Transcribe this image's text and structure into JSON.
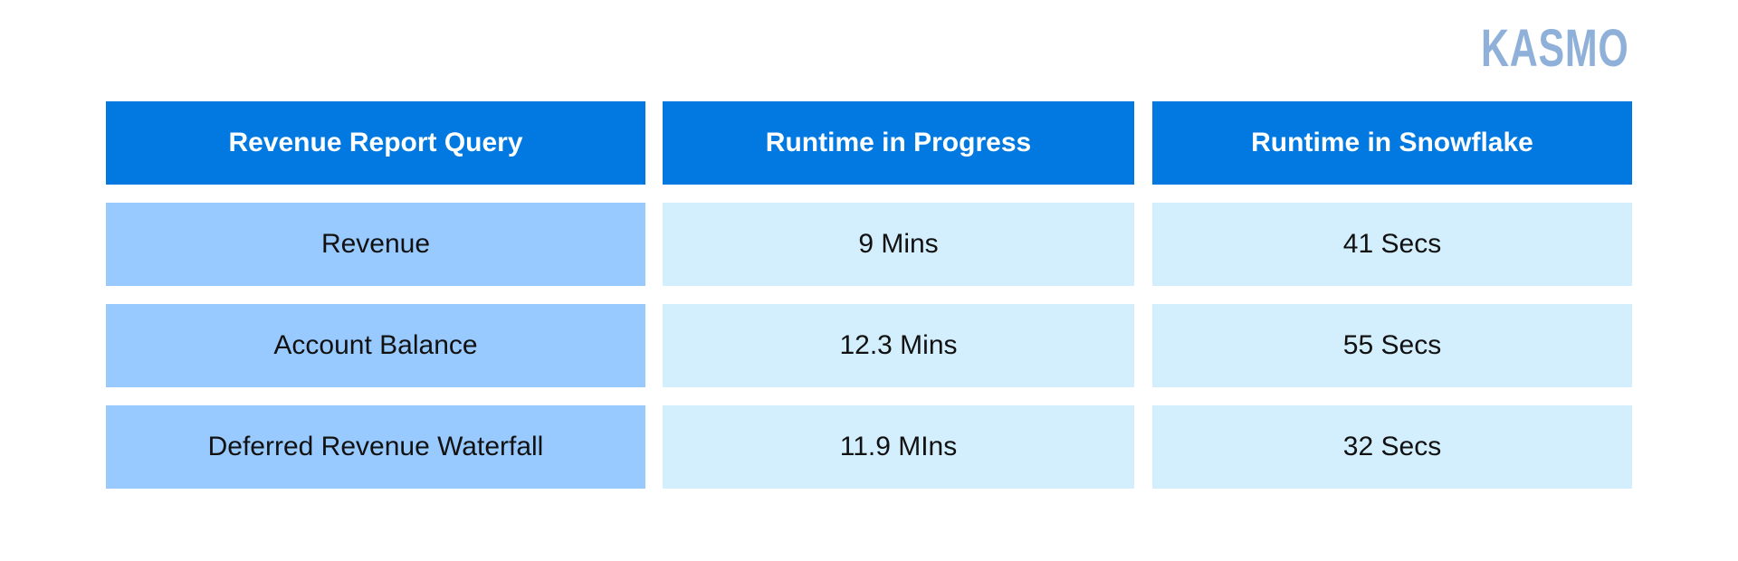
{
  "brand": {
    "logo_text": "KASMO",
    "color": "#8fb0d9"
  },
  "colors": {
    "header_bg": "#0179e0",
    "first_column_bg": "#99caff",
    "value_cell_bg": "#d3effd"
  },
  "table": {
    "headers": [
      "Revenue Report Query",
      "Runtime in Progress",
      "Runtime in Snowflake"
    ],
    "rows": [
      [
        "Revenue",
        "9 Mins",
        "41 Secs"
      ],
      [
        "Account Balance",
        "12.3 Mins",
        "55 Secs"
      ],
      [
        "Deferred Revenue Waterfall",
        "11.9 MIns",
        "32 Secs"
      ]
    ]
  }
}
